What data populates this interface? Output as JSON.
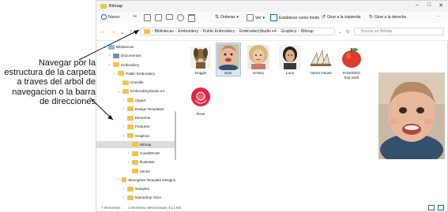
{
  "callout": {
    "lines": [
      "Navegar por la",
      "estructura de la carpeta",
      "a traves del arbol de",
      "navegacion o la barra",
      "de direcciones"
    ]
  },
  "window": {
    "title": "Bitmap",
    "controls": [
      "–",
      "□",
      "✕"
    ]
  },
  "ribbon": {
    "nuevo": "Nuevo",
    "ordenar": "Ordenar",
    "ver": "Ver",
    "fondo": "Establecer como fondo",
    "girar_izq": "Girar a la izquierda",
    "girar_der": "Girar a la derecha",
    "more": "···"
  },
  "address": {
    "path": [
      "Bibliotecas",
      "Embroidery",
      "Public Embroidery",
      "EmbroideryStudio e4",
      "Graphics",
      "Bitmap"
    ],
    "search_placeholder": "Buscar en Bitmap"
  },
  "nav": [
    {
      "label": "Bibliotecas",
      "indent": 0,
      "chevron": "v"
    },
    {
      "label": "Documentos",
      "indent": 1,
      "chevron": ">"
    },
    {
      "label": "Embroidery",
      "indent": 1,
      "chevron": "v"
    },
    {
      "label": "Public Embroidery",
      "indent": 2,
      "chevron": "v"
    },
    {
      "label": "Chenille",
      "indent": 3,
      "chevron": ""
    },
    {
      "label": "EmbroideryStudio e4",
      "indent": 3,
      "chevron": "v"
    },
    {
      "label": "Clipart",
      "indent": 4,
      "chevron": ">"
    },
    {
      "label": "Design Templates",
      "indent": 4,
      "chevron": ">"
    },
    {
      "label": "Elements",
      "indent": 4,
      "chevron": ""
    },
    {
      "label": "Features",
      "indent": 4,
      "chevron": ">"
    },
    {
      "label": "Graphics",
      "indent": 4,
      "chevron": "v"
    },
    {
      "label": "Bitmap",
      "indent": 5,
      "chevron": "",
      "selected": true
    },
    {
      "label": "CorelDRAW",
      "indent": 5,
      "chevron": ">"
    },
    {
      "label": "Illustrator",
      "indent": 5,
      "chevron": ">"
    },
    {
      "label": "Vector",
      "indent": 5,
      "chevron": ""
    },
    {
      "label": "Monogram Template Designs",
      "indent": 4,
      "chevron": ">"
    },
    {
      "label": "Samples",
      "indent": 4,
      "chevron": ">"
    },
    {
      "label": "Namedrop Sizer",
      "indent": 4,
      "chevron": ">"
    }
  ],
  "files": [
    {
      "name": "Doggie",
      "kind": "dog"
    },
    {
      "name": "Boie",
      "kind": "baby",
      "selected": true
    },
    {
      "name": "Kelsey",
      "kind": "girl"
    },
    {
      "name": "Luca",
      "kind": "man"
    },
    {
      "name": "Opera House",
      "kind": "opera"
    },
    {
      "name": "PointStitch fruit work",
      "kind": "apple"
    },
    {
      "name": "Rose",
      "kind": "rose"
    }
  ],
  "status": {
    "count": "7 elementos",
    "selected": "1 elemento seleccionado  42,1 KB"
  },
  "colors": {
    "accent": "#0067c0",
    "folder": "#f2c24a",
    "apple": "#e03b2b",
    "rose": "#e3263f"
  }
}
